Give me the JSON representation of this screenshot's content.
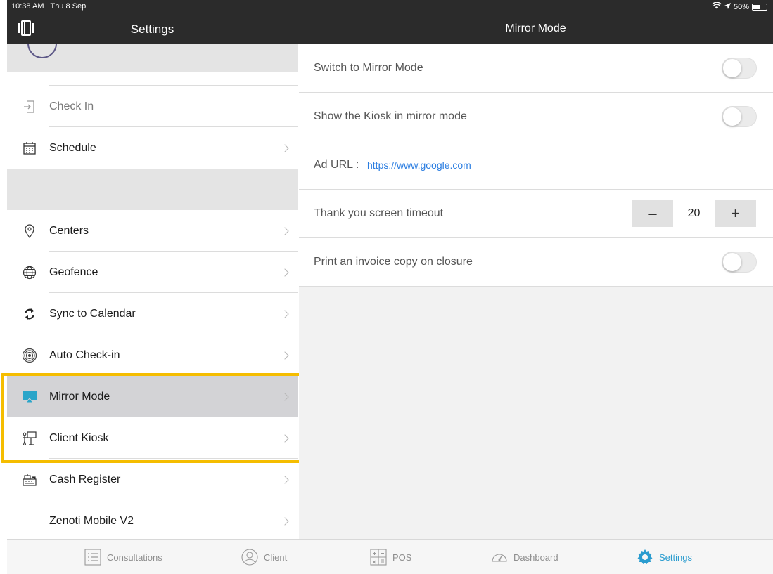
{
  "status_bar": {
    "time": "10:38 AM",
    "date": "Thu 8 Sep",
    "battery": "50%"
  },
  "nav": {
    "left_title": "Settings",
    "right_title": "Mirror Mode"
  },
  "sidebar": {
    "items": [
      {
        "label": "Check In",
        "icon": "check-in-icon",
        "chevron": false
      },
      {
        "label": "Schedule",
        "icon": "calendar-icon",
        "chevron": true
      },
      {
        "label": "Centers",
        "icon": "location-pin-icon",
        "chevron": true
      },
      {
        "label": "Geofence",
        "icon": "globe-icon",
        "chevron": true
      },
      {
        "label": "Sync to Calendar",
        "icon": "sync-icon",
        "chevron": true
      },
      {
        "label": "Auto Check-in",
        "icon": "signal-icon",
        "chevron": true
      },
      {
        "label": "Mirror Mode",
        "icon": "airplay-icon",
        "chevron": true,
        "selected": true
      },
      {
        "label": "Client Kiosk",
        "icon": "kiosk-icon",
        "chevron": true
      },
      {
        "label": "Cash Register",
        "icon": "cash-register-icon",
        "chevron": true
      },
      {
        "label": "Zenoti Mobile V2",
        "icon": "",
        "chevron": true
      }
    ]
  },
  "detail": {
    "switch_mirror": {
      "label": "Switch to Mirror Mode",
      "on": false
    },
    "show_kiosk": {
      "label": "Show the Kiosk in mirror mode",
      "on": false
    },
    "ad_url": {
      "label": "Ad URL :",
      "value": "https://www.google.com"
    },
    "timeout": {
      "label": "Thank you screen timeout",
      "value": "20",
      "minus": "–",
      "plus": "+"
    },
    "print_invoice": {
      "label": "Print an invoice copy on closure",
      "on": false
    }
  },
  "tabs": [
    {
      "label": "Consultations",
      "icon": "list-icon"
    },
    {
      "label": "Client",
      "icon": "person-icon"
    },
    {
      "label": "POS",
      "icon": "calculator-icon"
    },
    {
      "label": "Dashboard",
      "icon": "gauge-icon"
    },
    {
      "label": "Settings",
      "icon": "gear-icon",
      "active": true
    }
  ],
  "colors": {
    "accent": "#2a9ccf",
    "link": "#2a7de1",
    "highlight": "#f5bd00",
    "header": "#2b2b2b"
  }
}
